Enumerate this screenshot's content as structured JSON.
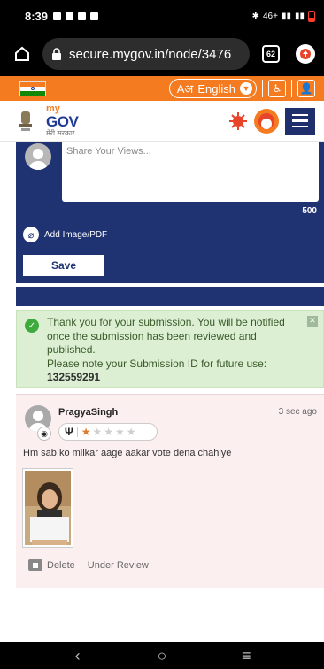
{
  "status_bar": {
    "time": "8:39",
    "network": "46+"
  },
  "browser": {
    "url": "secure.mygov.in/node/3476",
    "tab_count": "62"
  },
  "header": {
    "language_label": "English",
    "language_prefix": "Aअ"
  },
  "logo": {
    "my": "my",
    "gov": "GOV",
    "hindi": "मेरी सरकार"
  },
  "form": {
    "placeholder": "Share Your Views...",
    "char_count": "500",
    "attach_label": "Add Image/PDF",
    "save_label": "Save"
  },
  "alert": {
    "message": "Thank you for your submission. You will be notified once the submission has been reviewed and published.",
    "note": "Please note your Submission ID for future use:",
    "submission_id": "132559291"
  },
  "comment": {
    "author": "PragyaSingh",
    "time": "3 sec ago",
    "rating": 1,
    "rating_max": 5,
    "text": "Hm sab ko milkar aage aakar vote dena chahiye",
    "delete_label": "Delete",
    "status_label": "Under Review"
  },
  "nav": {
    "back": "‹",
    "home": "○",
    "recents": "≡"
  },
  "colors": {
    "saffron": "#f47b20",
    "navy": "#1f3373",
    "success_bg": "#dcefd3",
    "comment_bg": "#fcefef"
  }
}
